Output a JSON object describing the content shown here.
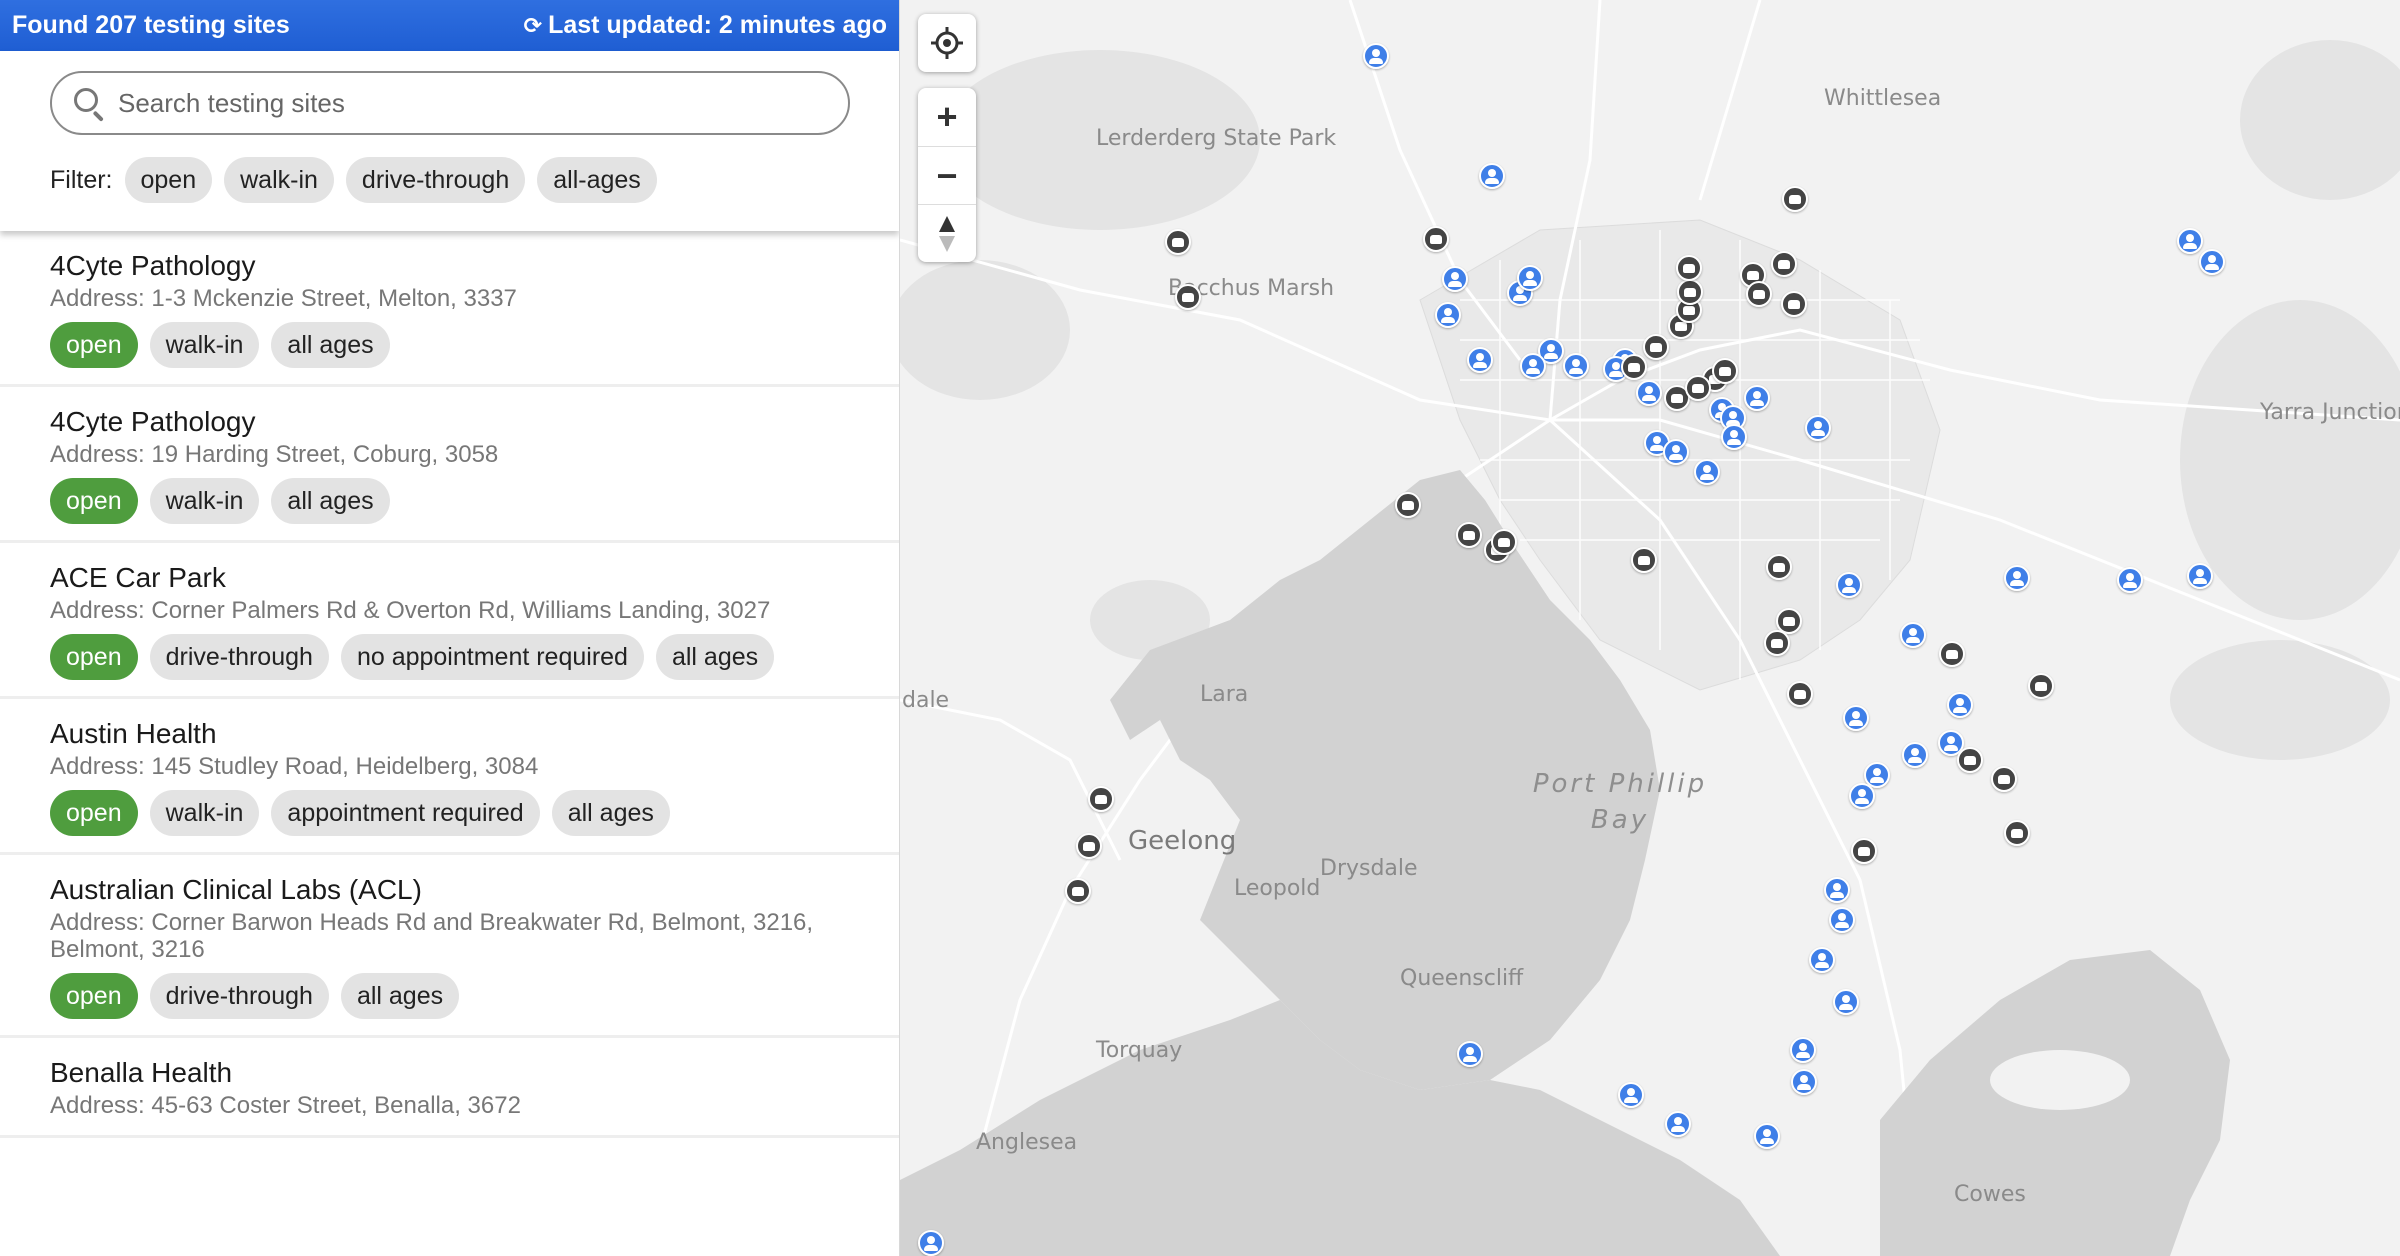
{
  "header": {
    "found_text": "Found 207 testing sites",
    "refresh_icon": "refresh-icon",
    "updated_text": "Last updated: 2 minutes ago"
  },
  "search": {
    "placeholder": "Search testing sites",
    "value": ""
  },
  "filters": {
    "label": "Filter:",
    "chips": [
      "open",
      "walk-in",
      "drive-through",
      "all-ages"
    ]
  },
  "sites": [
    {
      "name": "4Cyte Pathology",
      "address": "Address: 1-3 Mckenzie Street, Melton, 3337",
      "tags": [
        "open",
        "walk-in",
        "all ages"
      ]
    },
    {
      "name": "4Cyte Pathology",
      "address": "Address: 19 Harding Street, Coburg, 3058",
      "tags": [
        "open",
        "walk-in",
        "all ages"
      ]
    },
    {
      "name": "ACE Car Park",
      "address": "Address: Corner Palmers Rd & Overton Rd, Williams Landing, 3027",
      "tags": [
        "open",
        "drive-through",
        "no appointment required",
        "all ages"
      ]
    },
    {
      "name": "Austin Health",
      "address": "Address: 145 Studley Road, Heidelberg, 3084",
      "tags": [
        "open",
        "walk-in",
        "appointment required",
        "all ages"
      ]
    },
    {
      "name": "Australian Clinical Labs (ACL)",
      "address": "Address: Corner Barwon Heads Rd and Breakwater Rd, Belmont, 3216, Belmont, 3216",
      "tags": [
        "open",
        "drive-through",
        "all ages"
      ]
    },
    {
      "name": "Benalla Health",
      "address": "Address: 45-63 Coster Street, Benalla, 3672",
      "tags": []
    }
  ],
  "map": {
    "controls": {
      "locate_icon": "locate-icon",
      "zoom_in": "+",
      "zoom_out": "−",
      "compass": "▲"
    },
    "labels": {
      "whittlesea": "Whittlesea",
      "lerderderg": "Lerderderg State Park",
      "bacchus": "Bacchus Marsh",
      "yarra": "Yarra Junction",
      "dale": "dale",
      "lara": "Lara",
      "geelong": "Geelong",
      "drysdale": "Drysdale",
      "leopold": "Leopold",
      "queenscliff": "Queenscliff",
      "torquay": "Torquay",
      "anglesea": "Anglesea",
      "cowes": "Cowes",
      "bay_line1": "Port Phillip",
      "bay_line2": "Bay"
    },
    "marker_legend": {
      "walk": "walk-in-marker",
      "drive": "drive-through-marker"
    },
    "colors": {
      "walk_in": "#3f7fe8",
      "drive_through": "#444444",
      "open_chip": "#4f9d3e",
      "header": "#2466d8"
    }
  }
}
